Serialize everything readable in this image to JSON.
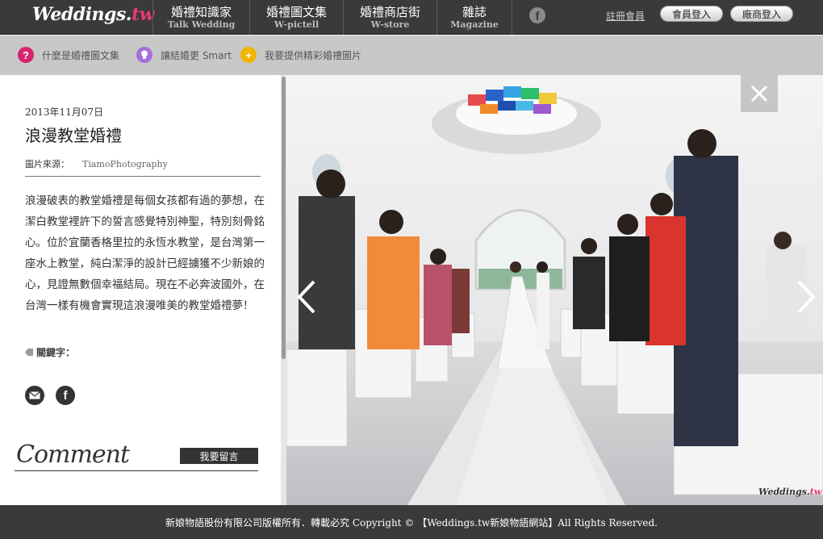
{
  "header": {
    "logo_main": "Weddings.",
    "logo_tld": "tw",
    "nav": [
      {
        "zh": "婚禮知識家",
        "en": "Talk Wedding",
        "width": 120
      },
      {
        "zh": "婚禮圖文集",
        "en": "W-pictell",
        "width": 116
      },
      {
        "zh": "婚禮商店街",
        "en": "W-store",
        "width": 116
      },
      {
        "zh": "雜誌",
        "en": "Magazine",
        "width": 94
      }
    ],
    "facebook_icon": "facebook-icon",
    "register": "註冊會員",
    "member_login": "會員登入",
    "vendor_login": "廠商登入"
  },
  "subnav": [
    {
      "label": "什麼是婚禮圖文集",
      "icon": "?",
      "color": "#d6246e"
    },
    {
      "label": "讓結婚更 Smart",
      "icon": "lightbulb-icon",
      "color": "#a46fd8"
    },
    {
      "label": "我要提供精彩婚禮圖片",
      "icon": "+",
      "color": "#f2b600"
    }
  ],
  "article": {
    "date": "2013年11月07日",
    "title": "浪漫教堂婚禮",
    "source_label": "圖片來源：",
    "source_value": "TiamoPhotography",
    "description": "浪漫破表的教堂婚禮是每個女孩都有過的夢想，在潔白教堂裡許下的誓言感覺特別神聖，特別刻骨銘心。位於宜蘭香格里拉的永恆水教堂，是台灣第一座水上教堂，純白潔淨的設計已經擄獲不少新娘的心，見證無數個幸福結局。現在不必奔波國外，在台灣一樣有機會實現這浪漫唯美的教堂婚禮夢！",
    "keywords_label": "關鍵字："
  },
  "comment": {
    "title": "Comment",
    "button": "我要留言"
  },
  "watermark": {
    "main": "Weddings.",
    "tld": "tw"
  },
  "footer": "新娘物語股份有限公司版權所有．轉載必究 Copyright © 【Weddings.tw新娘物語網站】All Rights Reserved."
}
